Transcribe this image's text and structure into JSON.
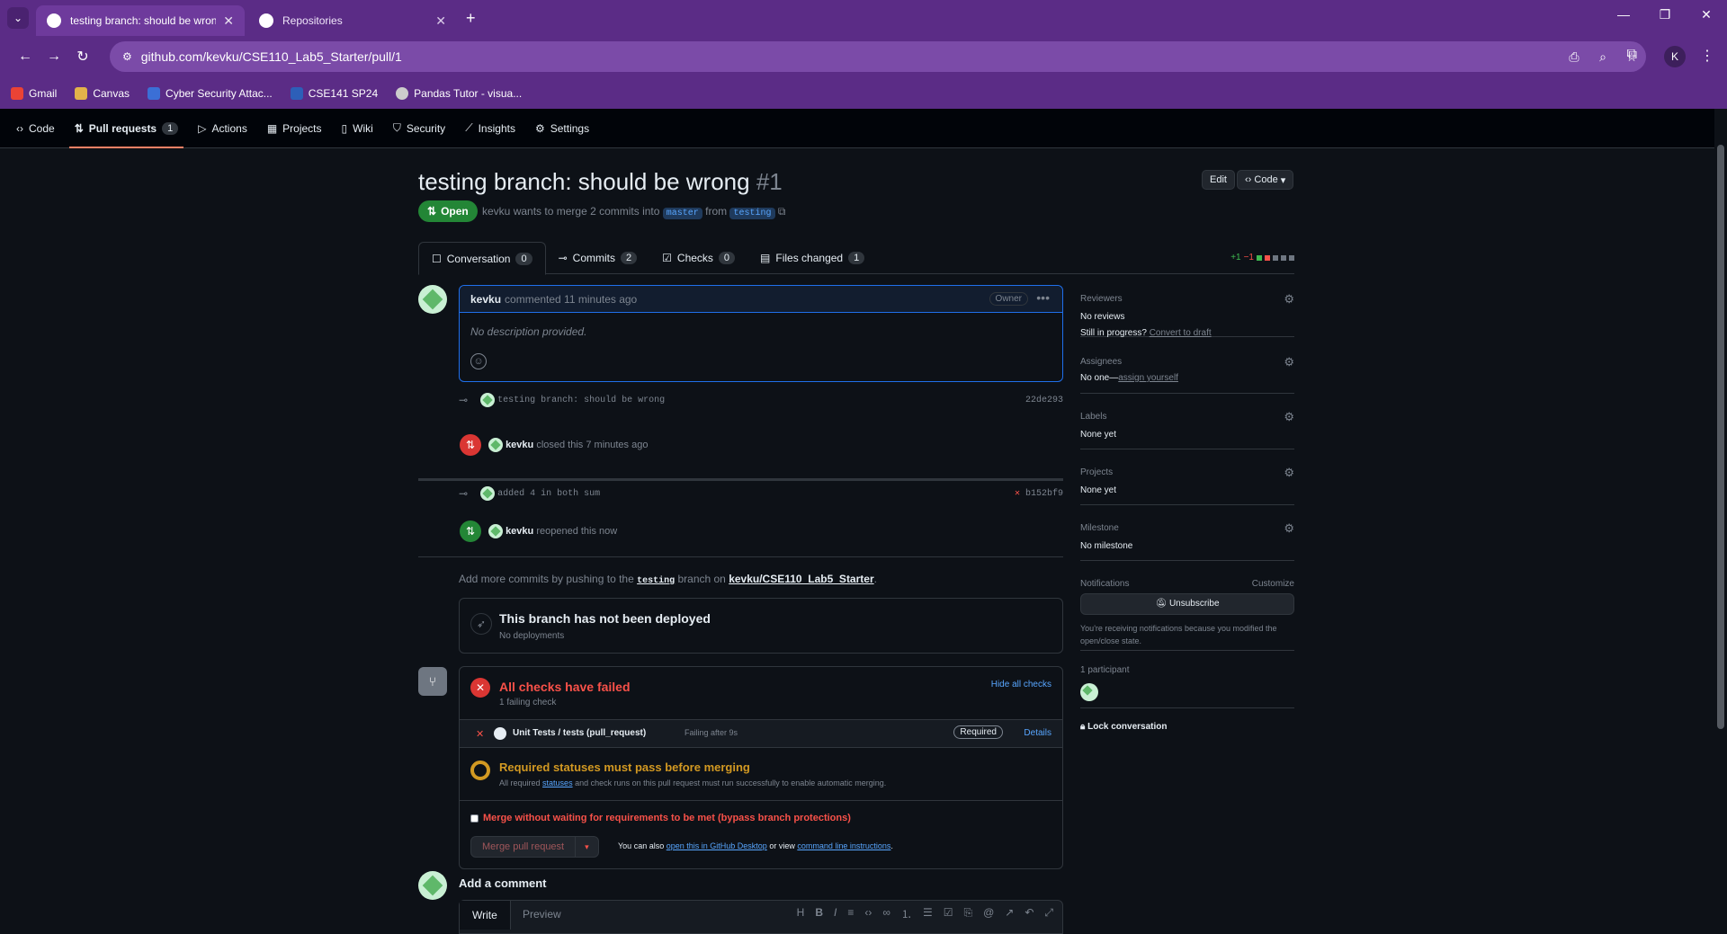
{
  "browser": {
    "tabs": [
      {
        "title": "testing branch: should be wrong"
      },
      {
        "title": "Repositories"
      }
    ],
    "url": "github.com/kevku/CSE110_Lab5_Starter/pull/1",
    "profile_initial": "K",
    "bookmarks": [
      {
        "label": "Gmail",
        "color": "#ea4335"
      },
      {
        "label": "Canvas",
        "color": "#e2b34a"
      },
      {
        "label": "Cyber Security Attac...",
        "color": "#3b6fd6"
      },
      {
        "label": "CSE141 SP24",
        "color": "#2d5fb8"
      },
      {
        "label": "Pandas Tutor - visua...",
        "color": "#cccccc"
      }
    ]
  },
  "repo_nav": {
    "items": [
      {
        "label": "Code",
        "icon": "code-icon"
      },
      {
        "label": "Pull requests",
        "icon": "pull-request-icon",
        "count": "1"
      },
      {
        "label": "Actions",
        "icon": "play-icon"
      },
      {
        "label": "Projects",
        "icon": "table-icon"
      },
      {
        "label": "Wiki",
        "icon": "book-icon"
      },
      {
        "label": "Security",
        "icon": "shield-icon"
      },
      {
        "label": "Insights",
        "icon": "graph-icon"
      },
      {
        "label": "Settings",
        "icon": "gear-icon"
      }
    ]
  },
  "pr": {
    "title": "testing branch: should be wrong",
    "number": "#1",
    "edit_label": "Edit",
    "code_label": "Code",
    "state": "Open",
    "author": "kevku",
    "meta_text": "wants to merge 2 commits into",
    "base_branch": "master",
    "from_text": "from",
    "head_branch": "testing"
  },
  "tabs": [
    {
      "label": "Conversation",
      "count": "0"
    },
    {
      "label": "Commits",
      "count": "2"
    },
    {
      "label": "Checks",
      "count": "0"
    },
    {
      "label": "Files changed",
      "count": "1"
    }
  ],
  "diffstat": {
    "added": "+1",
    "removed": "−1"
  },
  "comment": {
    "author": "kevku",
    "action": "commented 11 minutes ago",
    "role": "Owner",
    "body": "No description provided."
  },
  "timeline": {
    "commit1": {
      "message": "testing branch: should be wrong",
      "sha": "22de293"
    },
    "closed": {
      "author": "kevku",
      "text": "closed this 7 minutes ago"
    },
    "commit2": {
      "message": "added 4 in both sum",
      "sha": "b152bf9"
    },
    "reopened": {
      "author": "kevku",
      "text": "reopened this now"
    }
  },
  "hint": {
    "prefix": "Add more commits by pushing to the",
    "branch": "testing",
    "middle": "branch on",
    "repo": "kevku/CSE110_Lab5_Starter",
    "suffix": "."
  },
  "deploy": {
    "title": "This branch has not been deployed",
    "subtitle": "No deployments"
  },
  "checks": {
    "title": "All checks have failed",
    "subtitle": "1 failing check",
    "hide_label": "Hide all checks",
    "check_name": "Unit Tests / tests (pull_request)",
    "check_status": "Failing after 9s",
    "required": "Required",
    "details": "Details",
    "required_title": "Required statuses must pass before merging",
    "required_pre": "All required",
    "required_link": "statuses",
    "required_post": "and check runs on this pull request must run successfully to enable automatic merging.",
    "bypass_label": "Merge without waiting for requirements to be met (bypass branch protections)",
    "merge_button": "Merge pull request",
    "also_pre": "You can also",
    "also_link1": "open this in GitHub Desktop",
    "also_mid": "or view",
    "also_link2": "command line instructions",
    "also_post": "."
  },
  "sidebar": {
    "reviewers": {
      "title": "Reviewers",
      "value": "No reviews",
      "draft_pre": "Still in progress?",
      "draft_link": "Convert to draft"
    },
    "assignees": {
      "title": "Assignees",
      "value": "No one—",
      "link": "assign yourself"
    },
    "labels": {
      "title": "Labels",
      "value": "None yet"
    },
    "projects": {
      "title": "Projects",
      "value": "None yet"
    },
    "milestone": {
      "title": "Milestone",
      "value": "No milestone"
    },
    "notifications": {
      "title": "Notifications",
      "customize": "Customize",
      "button": "Unsubscribe",
      "reason": "You're receiving notifications because you modified the open/close state."
    },
    "participants": {
      "title": "1 participant"
    },
    "lock": "Lock conversation"
  },
  "add_comment": {
    "title": "Add a comment",
    "write": "Write",
    "preview": "Preview"
  }
}
